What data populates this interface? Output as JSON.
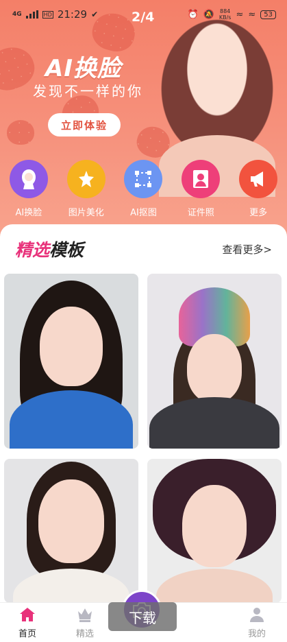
{
  "status_bar": {
    "network": "4G",
    "hd": "HD",
    "time": "21:29",
    "net_speed_value": "884",
    "net_speed_unit": "KB/s",
    "battery": "53"
  },
  "banner": {
    "pager": "2/4",
    "title": "AI换脸",
    "subtitle": "发现不一样的你",
    "cta": "立即体验"
  },
  "tools": [
    {
      "label": "AI换脸",
      "icon": "face-silhouette-icon",
      "color": "#8e59e6"
    },
    {
      "label": "图片美化",
      "icon": "sparkle-star-icon",
      "color": "#f6b21f"
    },
    {
      "label": "AI抠图",
      "icon": "cutout-frame-icon",
      "color": "#6c95f2"
    },
    {
      "label": "证件照",
      "icon": "id-photo-icon",
      "color": "#ee3f79"
    },
    {
      "label": "更多",
      "icon": "megaphone-icon",
      "color": "#f2533e"
    }
  ],
  "section": {
    "title_accent": "精选",
    "title_rest": "模板",
    "more": "查看更多>"
  },
  "templates": [
    {
      "name": "template-1",
      "bg": "#d9dcde",
      "hair": "#1f1613",
      "outfit": "#2e6fc9"
    },
    {
      "name": "template-2",
      "bg": "#e8e6ea",
      "hair": "#3a2a22",
      "outfit": "#3a3a40"
    },
    {
      "name": "template-3",
      "bg": "#e4e4e6",
      "hair": "#2a1c18",
      "outfit": "#f3efea"
    },
    {
      "name": "template-4",
      "bg": "#ececec",
      "hair": "#3a1f2b",
      "outfit": "#f1d2c4"
    }
  ],
  "bottom_nav": {
    "items": [
      {
        "label": "首页",
        "icon": "home-icon",
        "active": true
      },
      {
        "label": "精选",
        "icon": "crown-icon",
        "active": false
      },
      {
        "label": "我的",
        "icon": "person-icon",
        "active": false
      }
    ],
    "toast": "下载"
  },
  "colors": {
    "accent": "#e8317a",
    "active_nav": "#e8317a",
    "inactive_nav": "#b8b8c2",
    "fab": "#7c44c9"
  }
}
